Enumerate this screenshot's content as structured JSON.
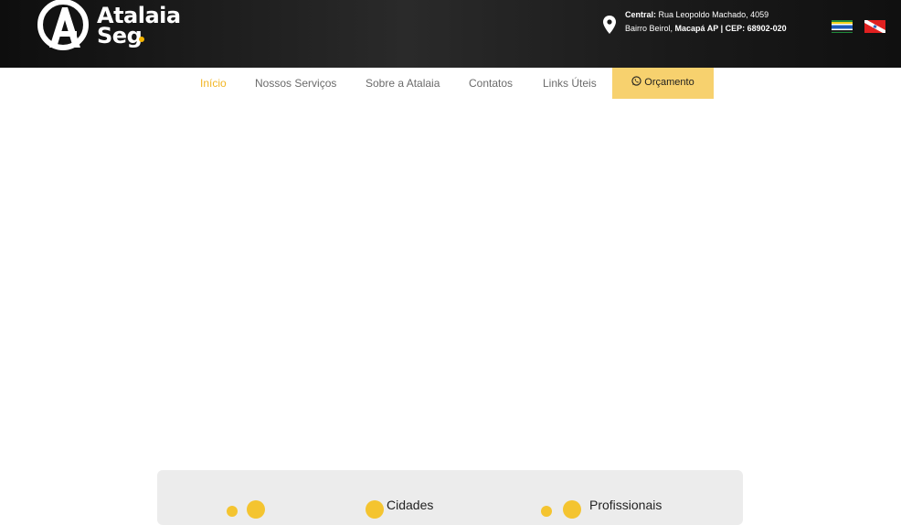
{
  "brand": {
    "logo_text_line1": "Atalaia",
    "logo_text_line2": "Seg"
  },
  "header": {
    "address_label": "Central:",
    "address_street": "Rua Leopoldo Machado, 4059",
    "address_district": "Bairro Beirol,",
    "address_city": "Macapá AP | CEP: 68902-020",
    "flags": [
      "amapa-flag-icon",
      "para-flag-icon"
    ]
  },
  "nav": {
    "items": [
      {
        "label": "Início",
        "active": true
      },
      {
        "label": "Nossos Serviços",
        "active": false
      },
      {
        "label": "Sobre a Atalaia",
        "active": false
      },
      {
        "label": "Contatos",
        "active": false
      },
      {
        "label": "Links Úteis",
        "active": false
      }
    ],
    "cta_label": "Orçamento",
    "cta_icon": "whatsapp-icon"
  },
  "stats": {
    "items": [
      {
        "label": ""
      },
      {
        "label": "Cidades"
      },
      {
        "label": "Profissionais"
      }
    ]
  },
  "colors": {
    "accent": "#f2b522",
    "cta_bg": "#f7d16e",
    "topbar_bg": "#1a1a1a",
    "stats_bg": "#ececec"
  }
}
